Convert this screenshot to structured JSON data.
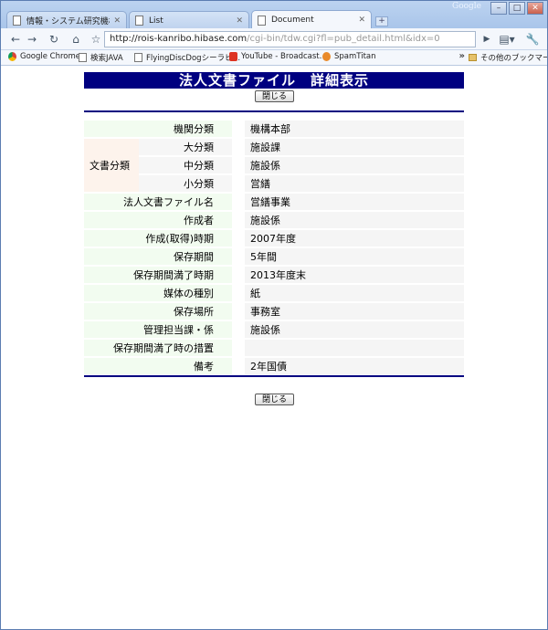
{
  "browser": {
    "brand_label": "Google",
    "window_buttons": [
      "minimize-icon",
      "maximize-icon",
      "close-icon"
    ],
    "tabs": [
      {
        "title": "情報・システム研究機構【大…",
        "active": false
      },
      {
        "title": "List",
        "active": false
      },
      {
        "title": "Document",
        "active": true
      }
    ],
    "new_tab_label": "+",
    "url_host": "http://rois-kanribo.hibase.com",
    "url_path": "/cgi-bin/tdw.cgi?fl=pub_detail.html&idx=0",
    "bookmarks": [
      {
        "label": "Google Chrome",
        "icon": "chrome-icon"
      },
      {
        "label": "検索JAVA",
        "icon": "page-icon"
      },
      {
        "label": "FlyingDiscDogシーラビ…",
        "icon": "page-icon"
      },
      {
        "label": "YouTube - Broadcast…",
        "icon": "youtube-icon"
      },
      {
        "label": "SpamTitan",
        "icon": "spamtitan-icon"
      }
    ],
    "bookmarks_overflow": "»",
    "other_bookmarks": "その他のブックマーク"
  },
  "page": {
    "heading": "法人文書ファイル　詳細表示",
    "close_button": "閉じる",
    "rows": {
      "kikan_label": "機関分類",
      "kikan_value": "機構本部",
      "bunsho_group": "文書分類",
      "dai_label": "大分類",
      "dai_value": "施設課",
      "chu_label": "中分類",
      "chu_value": "施設係",
      "sho_label": "小分類",
      "sho_value": "営繕",
      "filename_label": "法人文書ファイル名",
      "filename_value": "営繕事業",
      "creator_label": "作成者",
      "creator_value": "施設係",
      "created_label": "作成(取得)時期",
      "created_value": "2007年度",
      "period_label": "保存期間",
      "period_value": "5年間",
      "expiry_label": "保存期間満了時期",
      "expiry_value": "2013年度末",
      "media_label": "媒体の種別",
      "media_value": "紙",
      "place_label": "保存場所",
      "place_value": "事務室",
      "manager_label": "管理担当課・係",
      "manager_value": "施設係",
      "action_label": "保存期間満了時の措置",
      "action_value": "",
      "note_label": "備考",
      "note_value": "2年国債"
    }
  }
}
